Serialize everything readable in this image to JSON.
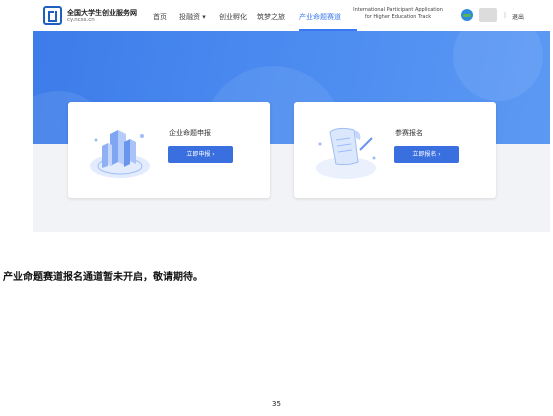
{
  "nav": {
    "logo_title": "全国大学生创业服务网",
    "logo_sub": "cy.ncss.cn",
    "items": [
      "首页",
      "投融资 ▾",
      "创业孵化",
      "筑梦之旅",
      "产业命题赛道"
    ],
    "intl_line1": "International Participant Application",
    "intl_line2": "for Higher Education Track",
    "separator": "|",
    "logout": "退出"
  },
  "cards": [
    {
      "title": "企业命题申报",
      "button": "立即申报 ›"
    },
    {
      "title": "参赛报名",
      "button": "立即报名 ›"
    }
  ],
  "caption": "产业命题赛道报名通道暂未开启，敬请期待。",
  "page_number": "35",
  "colors": {
    "primary": "#3a6fe0",
    "banner": "#4a8af0",
    "active_nav": "#3a78f2"
  }
}
